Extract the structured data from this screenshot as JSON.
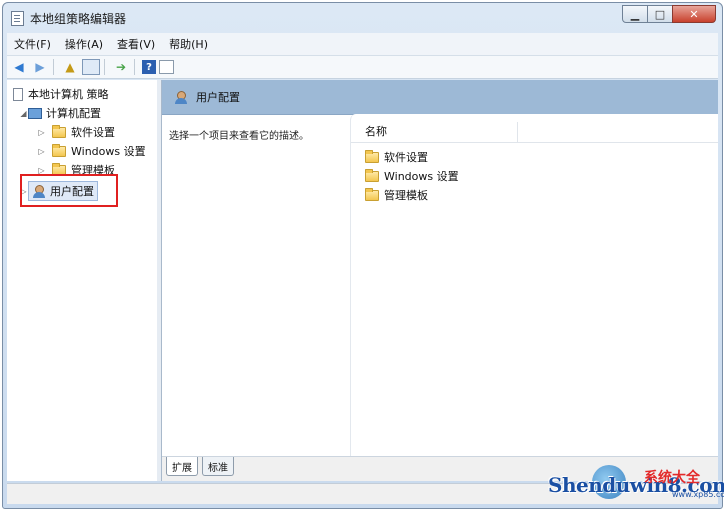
{
  "window": {
    "title": "本地组策略编辑器"
  },
  "menu": [
    "文件(F)",
    "操作(A)",
    "查看(V)",
    "帮助(H)"
  ],
  "tree": {
    "root": "本地计算机 策略",
    "computer": "计算机配置",
    "children": [
      "软件设置",
      "Windows 设置",
      "管理模板"
    ],
    "user": "用户配置"
  },
  "right": {
    "header": "用户配置",
    "description": "选择一个项目来查看它的描述。",
    "column_name": "名称",
    "items": [
      "软件设置",
      "Windows 设置",
      "管理模板"
    ]
  },
  "tabs": [
    "扩展",
    "标准"
  ],
  "watermark": {
    "brand": "Shenduwin8.com",
    "cn": "系统大全",
    "url": "www.xp85.com"
  },
  "colors": {
    "header_bg": "#9db9d6",
    "highlight": "#e02020"
  }
}
